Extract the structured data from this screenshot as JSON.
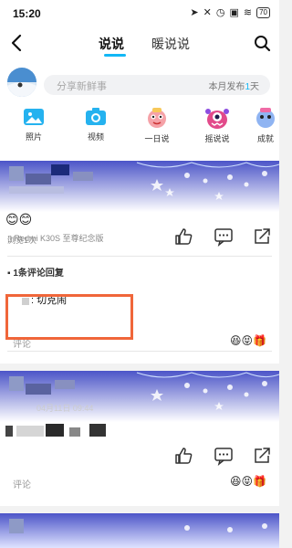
{
  "status": {
    "time": "15:20",
    "battery": "70"
  },
  "nav": {
    "tabs": [
      "说说",
      "暖说说"
    ]
  },
  "share": {
    "placeholder": "分享新鲜事",
    "stat_prefix": "本月发布",
    "stat_days": "1",
    "stat_suffix": "天"
  },
  "features": [
    {
      "label": "照片",
      "icon": "photo-icon"
    },
    {
      "label": "视频",
      "icon": "camera-icon"
    },
    {
      "label": "一日说",
      "icon": "mascot-pink-icon"
    },
    {
      "label": "摇说说",
      "icon": "monster-icon"
    },
    {
      "label": "成就",
      "icon": "mascot-icon"
    }
  ],
  "post1": {
    "emoji": "😊😊",
    "device": "Redmi K30S 至尊纪念版",
    "views": "浏览1次",
    "comment_header": "1条评论回复",
    "comment_text": ": 切克闹",
    "comment_placeholder": "评论",
    "emoji_pack": "😆😝🎁"
  },
  "post2": {
    "date_text": "04月11日 09:44",
    "comment_placeholder": "评论",
    "emoji_pack": "😆😝🎁"
  },
  "colors": {
    "accent": "#12b7f5",
    "highlight": "#f0663a",
    "banner": "#4d57c9"
  }
}
